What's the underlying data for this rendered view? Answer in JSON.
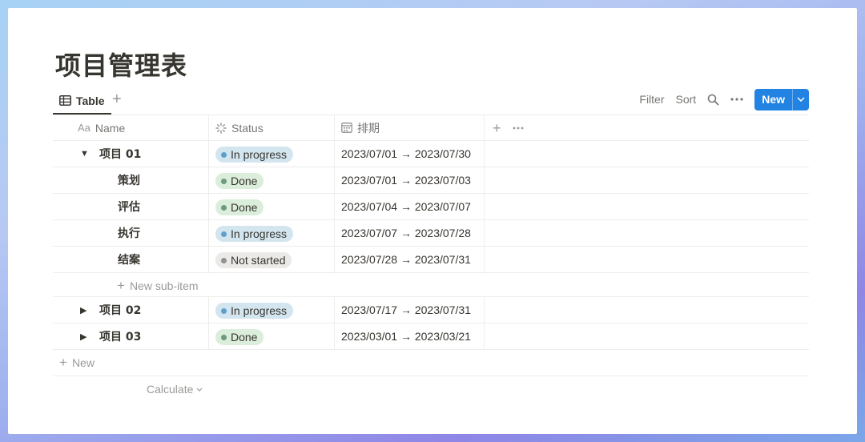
{
  "page": {
    "title": "项目管理表"
  },
  "view": {
    "tab_label": "Table"
  },
  "toolbar": {
    "filter": "Filter",
    "sort": "Sort",
    "new_label": "New"
  },
  "columns": {
    "name": "Name",
    "name_icon": "Aa",
    "status": "Status",
    "date": "排期"
  },
  "colors": {
    "in_progress_bg": "#d3e5ef",
    "in_progress_dot": "#5e9fcc",
    "done_bg": "#dbeddb",
    "done_dot": "#6c9b7d",
    "not_started_bg": "#ebeae8",
    "not_started_dot": "#91918e",
    "accent": "#2383e2"
  },
  "rows": [
    {
      "name": "项目 01",
      "status": "In progress",
      "date": "2023/07/01 → 2023/07/30"
    },
    {
      "name": "策划",
      "status": "Done",
      "date": "2023/07/01 → 2023/07/03"
    },
    {
      "name": "评估",
      "status": "Done",
      "date": "2023/07/04 → 2023/07/07"
    },
    {
      "name": "执行",
      "status": "In progress",
      "date": "2023/07/07 → 2023/07/28"
    },
    {
      "name": "结案",
      "status": "Not started",
      "date": "2023/07/28 → 2023/07/31"
    },
    {
      "name": "项目 02",
      "status": "In progress",
      "date": "2023/07/17 → 2023/07/31"
    },
    {
      "name": "项目 03",
      "status": "Done",
      "date": "2023/03/01 → 2023/03/21"
    }
  ],
  "sub_item_new": "New sub-item",
  "new_row": "New",
  "calculate": "Calculate"
}
